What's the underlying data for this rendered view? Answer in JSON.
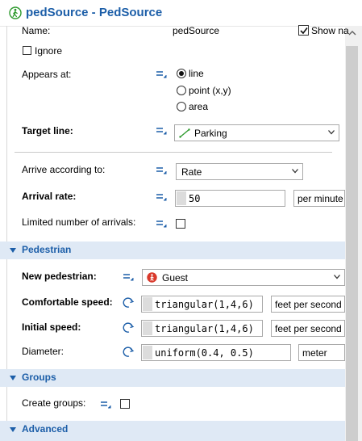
{
  "title": "pedSource - PedSource",
  "name_label": "Name:",
  "name_value": "pedSource",
  "show_name_label": "Show na",
  "ignore_label": "Ignore",
  "appears_at": {
    "label": "Appears at:",
    "options": [
      "line",
      "point (x,y)",
      "area"
    ],
    "selected": "line"
  },
  "target_line": {
    "label": "Target line:",
    "value": "Parking"
  },
  "arrive_according": {
    "label": "Arrive according to:",
    "value": "Rate"
  },
  "arrival_rate": {
    "label": "Arrival rate:",
    "value": "50",
    "unit": "per minute"
  },
  "limited_label": "Limited number of arrivals:",
  "sections": {
    "pedestrian": "Pedestrian",
    "groups": "Groups",
    "advanced": "Advanced"
  },
  "new_pedestrian": {
    "label": "New pedestrian:",
    "value": "Guest"
  },
  "comfortable_speed": {
    "label": "Comfortable speed:",
    "value": "triangular(1,4,6)",
    "unit": "feet per second"
  },
  "initial_speed": {
    "label": "Initial speed:",
    "value": "triangular(1,4,6)",
    "unit": "feet per second"
  },
  "diameter": {
    "label": "Diameter:",
    "value": "uniform(0.4, 0.5)",
    "unit": "meter"
  },
  "create_groups_label": "Create groups:",
  "colors": {
    "accent": "#1c5ea8",
    "section_bg": "#dfe9f5",
    "guest_icon": "#d9392b",
    "title_icon": "#2e9a2e"
  }
}
